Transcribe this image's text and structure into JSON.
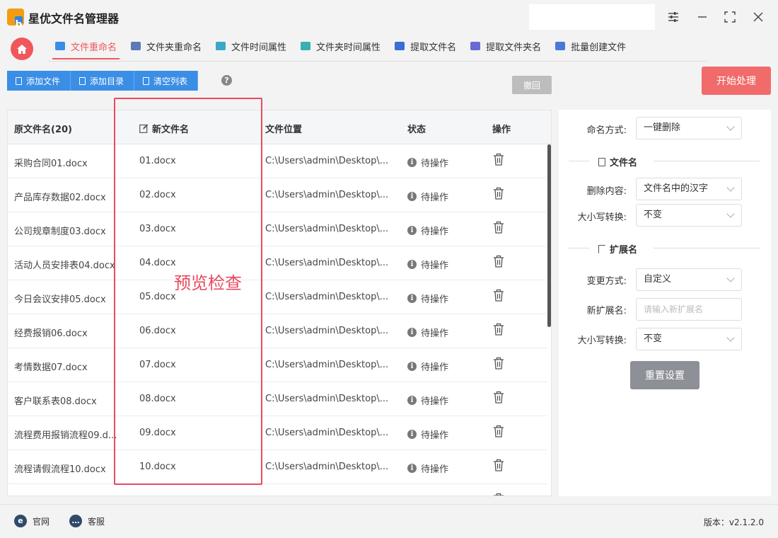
{
  "app": {
    "title": "星优文件名管理器",
    "logo_letter": "b"
  },
  "tabs": [
    {
      "label": "文件重命名",
      "color": "#3a8ee6"
    },
    {
      "label": "文件夹重命名",
      "color": "#5a7bb5"
    },
    {
      "label": "文件时间属性",
      "color": "#3aa8c6"
    },
    {
      "label": "文件夹时间属性",
      "color": "#3ab0b0"
    },
    {
      "label": "提取文件名",
      "color": "#3a6ed6"
    },
    {
      "label": "提取文件夹名",
      "color": "#6a6ad6"
    },
    {
      "label": "批量创建文件",
      "color": "#4a7ad6"
    }
  ],
  "toolbar": {
    "add_file": "添加文件",
    "add_dir": "添加目录",
    "clear_list": "清空列表",
    "help": "?",
    "undo": "撤回",
    "start": "开始处理"
  },
  "table": {
    "headers": {
      "orig": "原文件名(20)",
      "new": "新文件名",
      "path": "文件位置",
      "status": "状态",
      "op": "操作"
    },
    "rows": [
      {
        "orig": "采购合同01.docx",
        "new": "01.docx",
        "path": "C:\\Users\\admin\\Desktop\\...",
        "status": "待操作"
      },
      {
        "orig": "产品库存数据02.docx",
        "new": "02.docx",
        "path": "C:\\Users\\admin\\Desktop\\...",
        "status": "待操作"
      },
      {
        "orig": "公司规章制度03.docx",
        "new": "03.docx",
        "path": "C:\\Users\\admin\\Desktop\\...",
        "status": "待操作"
      },
      {
        "orig": "活动人员安排表04.docx",
        "new": "04.docx",
        "path": "C:\\Users\\admin\\Desktop\\...",
        "status": "待操作"
      },
      {
        "orig": "今日会议安排05.docx",
        "new": "05.docx",
        "path": "C:\\Users\\admin\\Desktop\\...",
        "status": "待操作"
      },
      {
        "orig": "经费报销06.docx",
        "new": "06.docx",
        "path": "C:\\Users\\admin\\Desktop\\...",
        "status": "待操作"
      },
      {
        "orig": "考情数据07.docx",
        "new": "07.docx",
        "path": "C:\\Users\\admin\\Desktop\\...",
        "status": "待操作"
      },
      {
        "orig": "客户联系表08.docx",
        "new": "08.docx",
        "path": "C:\\Users\\admin\\Desktop\\...",
        "status": "待操作"
      },
      {
        "orig": "流程费用报销流程09.d...",
        "new": "09.docx",
        "path": "C:\\Users\\admin\\Desktop\\...",
        "status": "待操作"
      },
      {
        "orig": "流程请假流程10.docx",
        "new": "10.docx",
        "path": "C:\\Users\\admin\\Desktop\\...",
        "status": "待操作"
      }
    ]
  },
  "overlay": {
    "text": "预览检查"
  },
  "panel": {
    "naming_label": "命名方式:",
    "naming_value": "一键删除",
    "filename_section": "文件名",
    "delete_label": "删除内容:",
    "delete_value": "文件名中的汉字",
    "case1_label": "大小写转换:",
    "case1_value": "不变",
    "ext_section": "扩展名",
    "change_label": "变更方式:",
    "change_value": "自定义",
    "newext_label": "新扩展名:",
    "newext_placeholder": "请输入新扩展名",
    "case2_label": "大小写转换:",
    "case2_value": "不变",
    "reset": "重置设置"
  },
  "footer": {
    "website": "官网",
    "support": "客服",
    "version": "版本：v2.1.2.0"
  }
}
